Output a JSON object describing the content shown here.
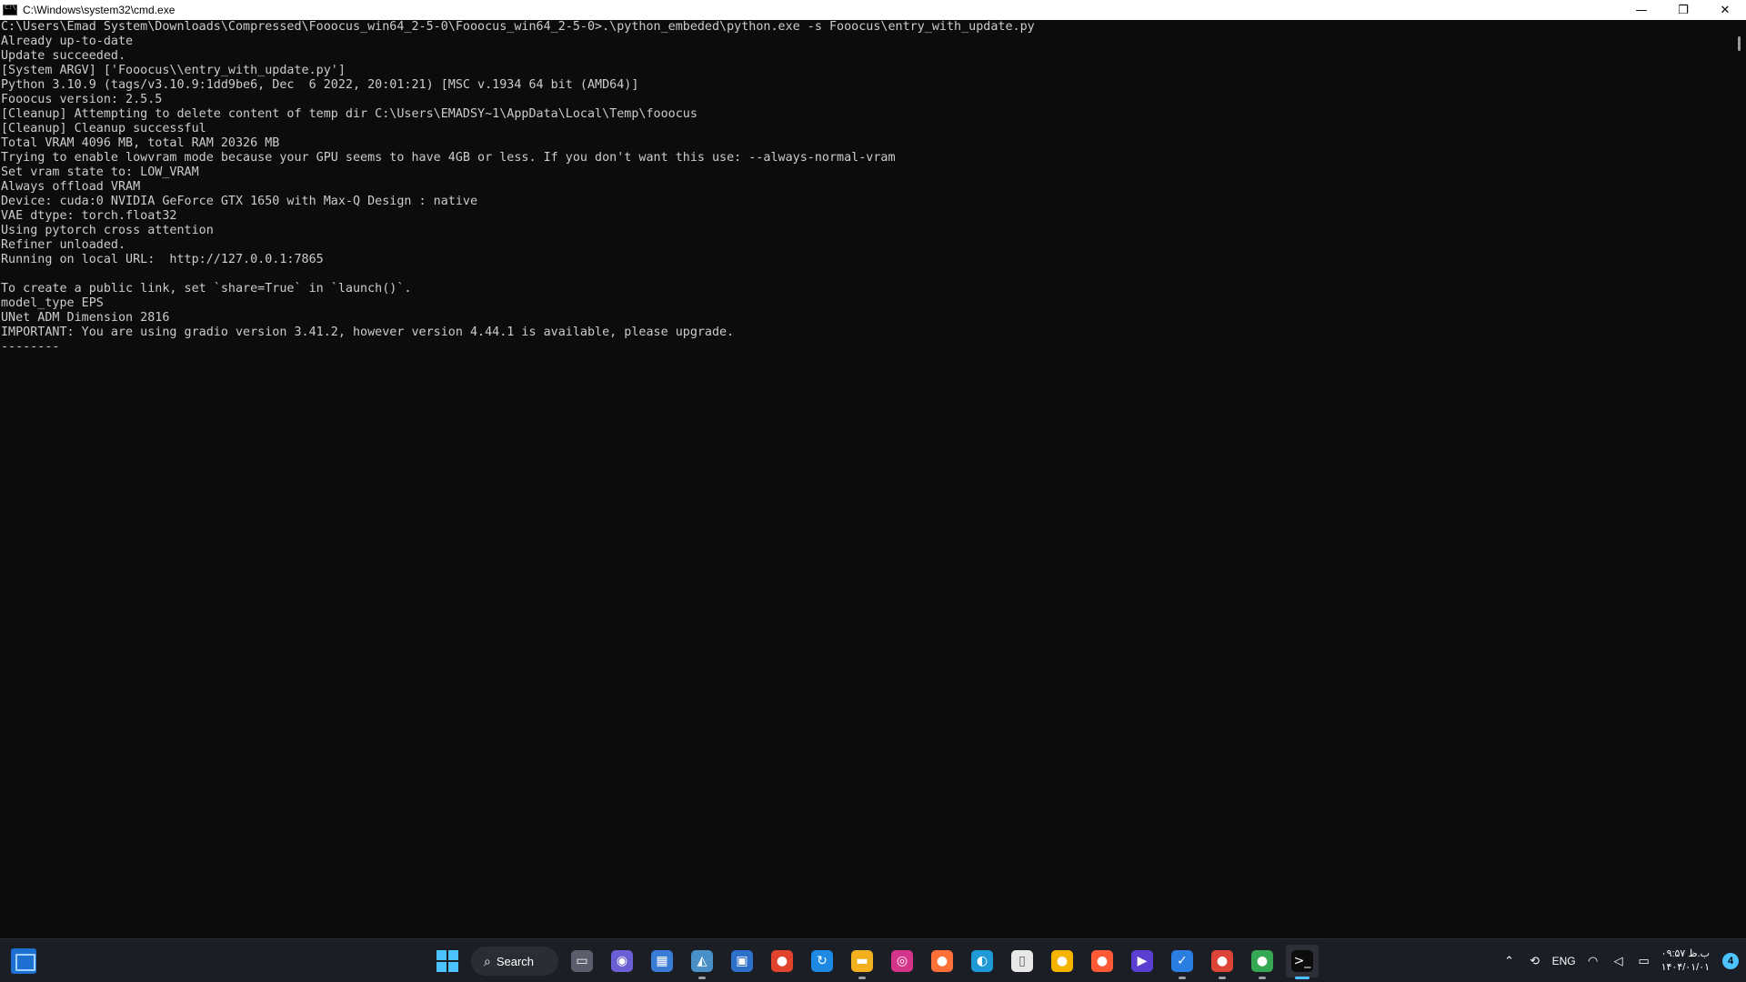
{
  "window": {
    "title": "C:\\Windows\\system32\\cmd.exe",
    "controls": {
      "minimize": "—",
      "restore": "❐",
      "close": "✕"
    }
  },
  "console": {
    "lines": [
      "C:\\Users\\Emad System\\Downloads\\Compressed\\Fooocus_win64_2-5-0\\Fooocus_win64_2-5-0>.\\python_embeded\\python.exe -s Fooocus\\entry_with_update.py",
      "Already up-to-date",
      "Update succeeded.",
      "[System ARGV] ['Fooocus\\\\entry_with_update.py']",
      "Python 3.10.9 (tags/v3.10.9:1dd9be6, Dec  6 2022, 20:01:21) [MSC v.1934 64 bit (AMD64)]",
      "Fooocus version: 2.5.5",
      "[Cleanup] Attempting to delete content of temp dir C:\\Users\\EMADSY~1\\AppData\\Local\\Temp\\fooocus",
      "[Cleanup] Cleanup successful",
      "Total VRAM 4096 MB, total RAM 20326 MB",
      "Trying to enable lowvram mode because your GPU seems to have 4GB or less. If you don't want this use: --always-normal-vram",
      "Set vram state to: LOW_VRAM",
      "Always offload VRAM",
      "Device: cuda:0 NVIDIA GeForce GTX 1650 with Max-Q Design : native",
      "VAE dtype: torch.float32",
      "Using pytorch cross attention",
      "Refiner unloaded.",
      "Running on local URL:  http://127.0.0.1:7865",
      "",
      "To create a public link, set `share=True` in `launch()`.",
      "model_type EPS",
      "UNet ADM Dimension 2816",
      "IMPORTANT: You are using gradio version 3.41.2, however version 4.44.1 is available, please upgrade.",
      "--------"
    ]
  },
  "taskbar": {
    "search_label": "Search",
    "apps": [
      {
        "icon": "task-view-icon",
        "glyph": "▭",
        "color": "#5a5f6b"
      },
      {
        "icon": "teams-chat-icon",
        "glyph": "◉",
        "color": "#6b5fd6"
      },
      {
        "icon": "control-panel-icon",
        "glyph": "▦",
        "color": "#3a7bd5"
      },
      {
        "icon": "task-manager-icon",
        "glyph": "◭",
        "color": "#4a90c8"
      },
      {
        "icon": "store-icon",
        "glyph": "▣",
        "color": "#2d6fc9"
      },
      {
        "icon": "chrome-icon",
        "glyph": "●",
        "color": "#e0442c"
      },
      {
        "icon": "sync-app-icon",
        "glyph": "↻",
        "color": "#1e88e5"
      },
      {
        "icon": "file-explorer-icon",
        "glyph": "▬",
        "color": "#f2b01e"
      },
      {
        "icon": "instagram-icon",
        "glyph": "◎",
        "color": "#d6338a"
      },
      {
        "icon": "firefox-icon",
        "glyph": "●",
        "color": "#ff7139"
      },
      {
        "icon": "edge-icon",
        "glyph": "◐",
        "color": "#1f9ad6"
      },
      {
        "icon": "notepad-icon",
        "glyph": "▯",
        "color": "#e8e8e8"
      },
      {
        "icon": "chrome-alt-icon",
        "glyph": "●",
        "color": "#f4b400"
      },
      {
        "icon": "firefox-alt-icon",
        "glyph": "●",
        "color": "#ff5a36"
      },
      {
        "icon": "media-player-icon",
        "glyph": "▶",
        "color": "#5b3fd1"
      },
      {
        "icon": "vpn-app-icon",
        "glyph": "✓",
        "color": "#2a7de1"
      },
      {
        "icon": "chrome-dev-icon",
        "glyph": "●",
        "color": "#db4437"
      },
      {
        "icon": "chrome-canary-icon",
        "glyph": "●",
        "color": "#34a853"
      },
      {
        "icon": "terminal-icon",
        "glyph": ">_",
        "color": "#0c0c0c"
      }
    ],
    "tray": {
      "language": "ENG",
      "time": "۰۹:۵۷ ب.ظ",
      "date": "۱۴۰۴/۰۱/۰۱",
      "notifications": "4"
    }
  }
}
